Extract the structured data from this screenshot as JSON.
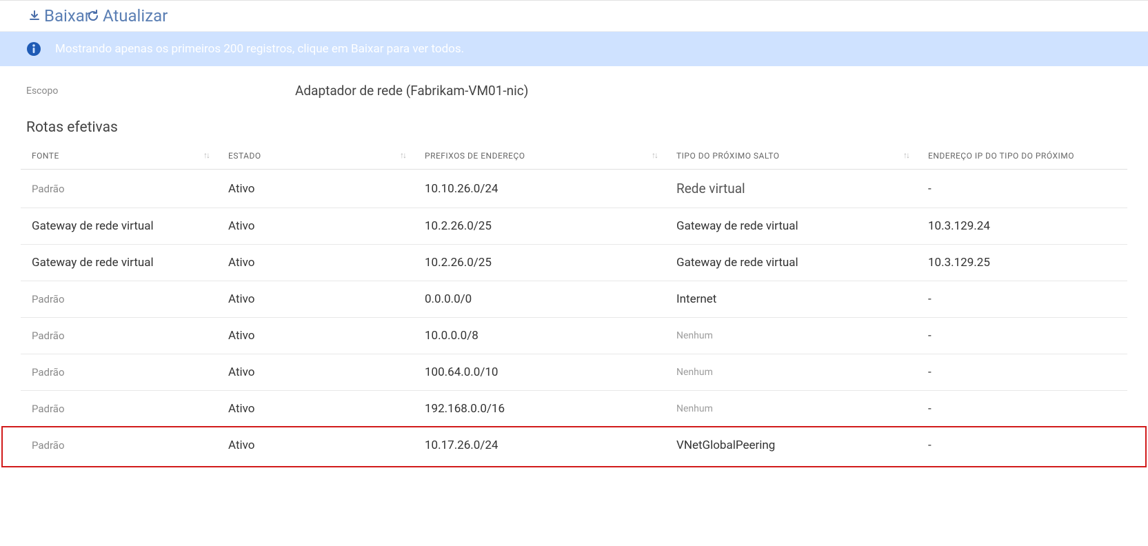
{
  "toolbar": {
    "download_label": "Baixar",
    "refresh_label": "Atualizar"
  },
  "info_bar": {
    "message": "Mostrando apenas os primeiros 200 registros, clique em Baixar para ver todos."
  },
  "scope": {
    "label": "Escopo",
    "value": "Adaptador de rede (Fabrikam-VM01-nic)"
  },
  "section_title": "Rotas efetivas",
  "columns": {
    "source": "Fonte",
    "state": "Estado",
    "prefix": "Prefixos de Endereço",
    "next_hop_type": "Tipo do Próximo Salto",
    "next_hop_ip": "Endereço IP do Tipo do Próximo"
  },
  "rows": [
    {
      "source": "Padrão",
      "state": "Ativo",
      "prefix": "10.10.26.0/24",
      "hop": "Rede virtual",
      "ip": "-",
      "muted_source": true,
      "bigger_hop": true
    },
    {
      "source": "Gateway de rede virtual",
      "state": "Ativo",
      "prefix": "10.2.26.0/25",
      "hop": "Gateway de rede virtual",
      "ip": "10.3.129.24"
    },
    {
      "source": "Gateway de rede virtual",
      "state": "Ativo",
      "prefix": "10.2.26.0/25",
      "hop": "Gateway de rede virtual",
      "ip": "10.3.129.25"
    },
    {
      "source": "Padrão",
      "state": "Ativo",
      "prefix": "0.0.0.0/0",
      "hop": "Internet",
      "ip": "-",
      "muted_source": true
    },
    {
      "source": "Padrão",
      "state": "Ativo",
      "prefix": "10.0.0.0/8",
      "hop": "Nenhum",
      "ip": "-",
      "muted_source": true,
      "small_hop": true
    },
    {
      "source": "Padrão",
      "state": "Ativo",
      "prefix": "100.64.0.0/10",
      "hop": "Nenhum",
      "ip": "-",
      "muted_source": true,
      "small_hop": true
    },
    {
      "source": "Padrão",
      "state": "Ativo",
      "prefix": "192.168.0.0/16",
      "hop": "Nenhum",
      "ip": "-",
      "muted_source": true,
      "small_hop": true
    },
    {
      "source": "Padrão",
      "state": "Ativo",
      "prefix": "10.17.26.0/24",
      "hop": "VNetGlobalPeering",
      "ip": "-",
      "muted_source": true,
      "highlight": true
    }
  ]
}
